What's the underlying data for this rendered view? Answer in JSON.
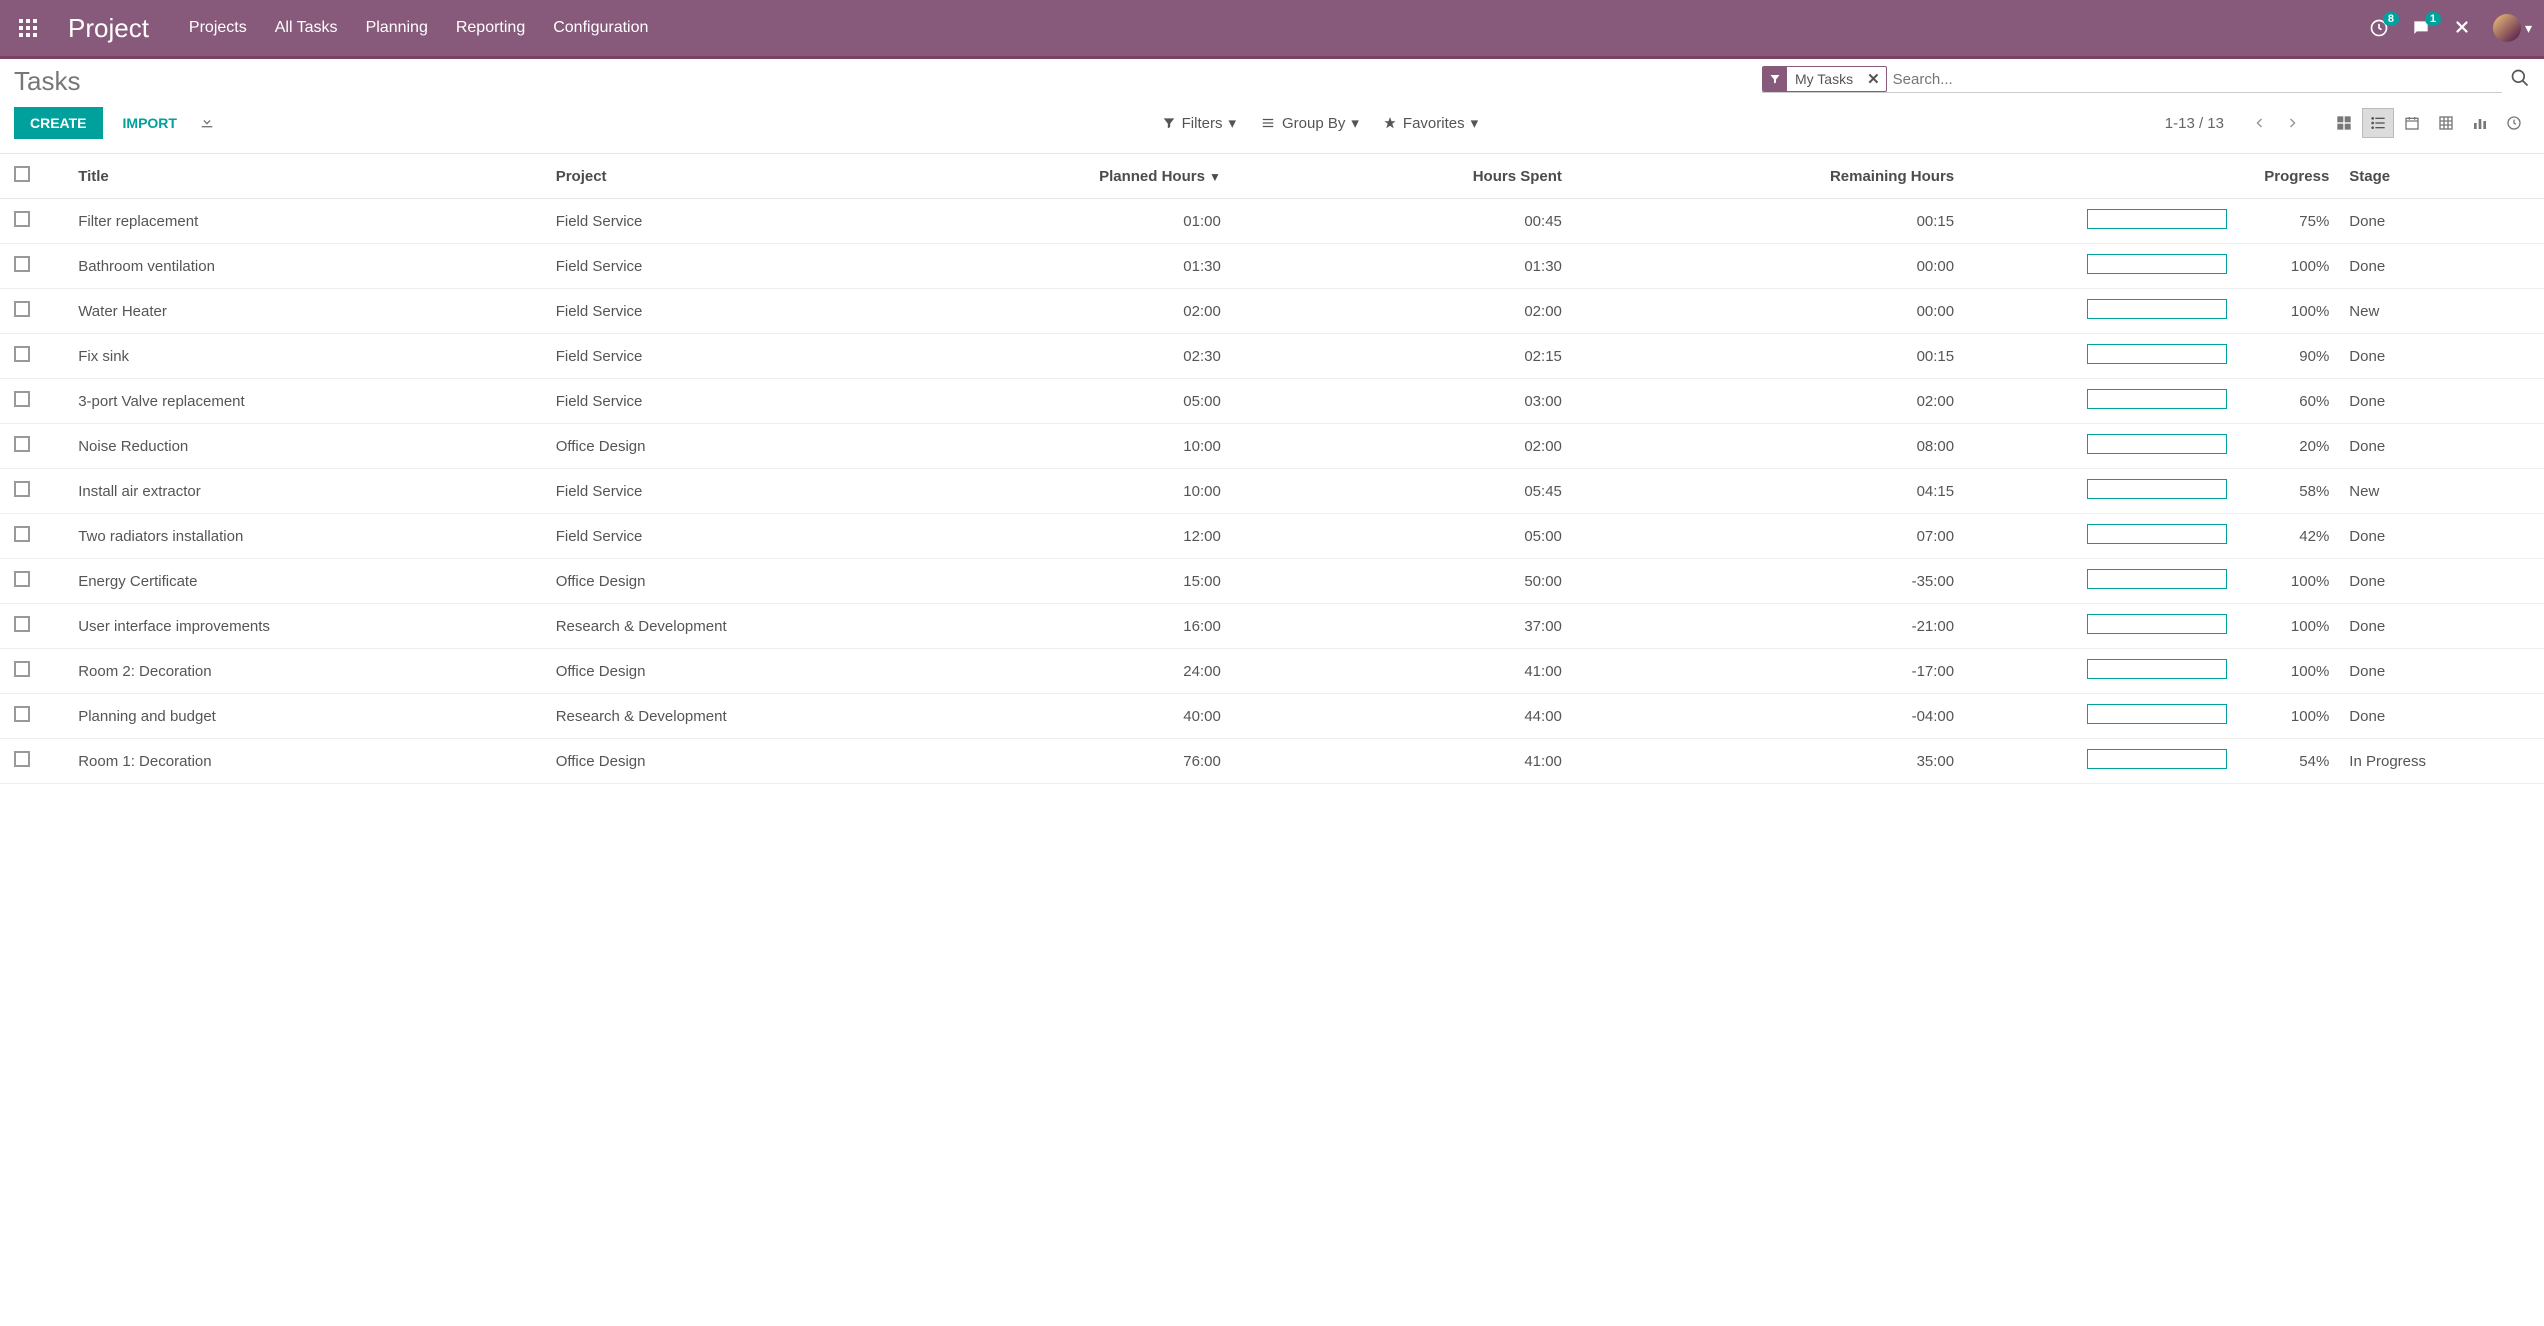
{
  "topbar": {
    "brand": "Project",
    "nav": [
      "Projects",
      "All Tasks",
      "Planning",
      "Reporting",
      "Configuration"
    ],
    "clock_badge": "8",
    "chat_badge": "1"
  },
  "page": {
    "title": "Tasks"
  },
  "search": {
    "facet_label": "My Tasks",
    "placeholder": "Search..."
  },
  "toolbar": {
    "create": "CREATE",
    "import": "IMPORT",
    "filters": "Filters",
    "group_by": "Group By",
    "favorites": "Favorites",
    "pager": "1-13 / 13"
  },
  "columns": {
    "title": "Title",
    "project": "Project",
    "planned": "Planned Hours",
    "spent": "Hours Spent",
    "remaining": "Remaining Hours",
    "progress": "Progress",
    "stage": "Stage"
  },
  "rows": [
    {
      "title": "Filter replacement",
      "project": "Field Service",
      "planned": "01:00",
      "spent": "00:45",
      "remaining": "00:15",
      "progress": 75,
      "pct": "75%",
      "stage": "Done"
    },
    {
      "title": "Bathroom ventilation",
      "project": "Field Service",
      "planned": "01:30",
      "spent": "01:30",
      "remaining": "00:00",
      "progress": 100,
      "pct": "100%",
      "stage": "Done"
    },
    {
      "title": "Water Heater",
      "project": "Field Service",
      "planned": "02:00",
      "spent": "02:00",
      "remaining": "00:00",
      "progress": 100,
      "pct": "100%",
      "stage": "New"
    },
    {
      "title": "Fix sink",
      "project": "Field Service",
      "planned": "02:30",
      "spent": "02:15",
      "remaining": "00:15",
      "progress": 90,
      "pct": "90%",
      "stage": "Done"
    },
    {
      "title": "3-port Valve replacement",
      "project": "Field Service",
      "planned": "05:00",
      "spent": "03:00",
      "remaining": "02:00",
      "progress": 60,
      "pct": "60%",
      "stage": "Done"
    },
    {
      "title": "Noise Reduction",
      "project": "Office Design",
      "planned": "10:00",
      "spent": "02:00",
      "remaining": "08:00",
      "progress": 20,
      "pct": "20%",
      "stage": "Done"
    },
    {
      "title": "Install air extractor",
      "project": "Field Service",
      "planned": "10:00",
      "spent": "05:45",
      "remaining": "04:15",
      "progress": 58,
      "pct": "58%",
      "stage": "New"
    },
    {
      "title": "Two radiators installation",
      "project": "Field Service",
      "planned": "12:00",
      "spent": "05:00",
      "remaining": "07:00",
      "progress": 42,
      "pct": "42%",
      "stage": "Done"
    },
    {
      "title": "Energy Certificate",
      "project": "Office Design",
      "planned": "15:00",
      "spent": "50:00",
      "remaining": "-35:00",
      "progress": 100,
      "pct": "100%",
      "stage": "Done"
    },
    {
      "title": "User interface improvements",
      "project": "Research & Development",
      "planned": "16:00",
      "spent": "37:00",
      "remaining": "-21:00",
      "progress": 100,
      "pct": "100%",
      "stage": "Done"
    },
    {
      "title": "Room 2: Decoration",
      "project": "Office Design",
      "planned": "24:00",
      "spent": "41:00",
      "remaining": "-17:00",
      "progress": 100,
      "pct": "100%",
      "stage": "Done"
    },
    {
      "title": "Planning and budget",
      "project": "Research & Development",
      "planned": "40:00",
      "spent": "44:00",
      "remaining": "-04:00",
      "progress": 100,
      "pct": "100%",
      "stage": "Done"
    },
    {
      "title": "Room 1: Decoration",
      "project": "Office Design",
      "planned": "76:00",
      "spent": "41:00",
      "remaining": "35:00",
      "progress": 54,
      "pct": "54%",
      "stage": "In Progress"
    }
  ]
}
